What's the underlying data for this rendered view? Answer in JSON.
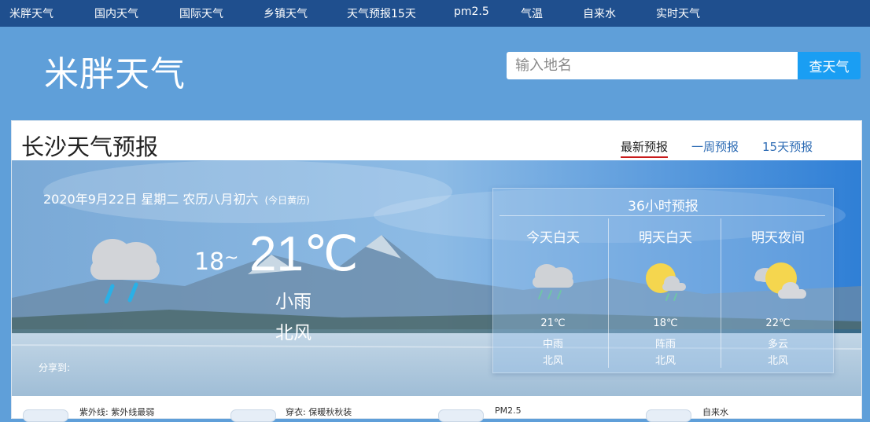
{
  "nav": {
    "items": [
      "米胖天气",
      "国内天气",
      "国际天气",
      "乡镇天气",
      "天气预报15天",
      "pm2.5",
      "气温",
      "自来水",
      "实时天气"
    ]
  },
  "header": {
    "logo": "米胖天气",
    "search_placeholder": "输入地名",
    "search_button": "查天气"
  },
  "card": {
    "title": "长沙天气预报",
    "tabs": [
      {
        "label": "最新预报",
        "active": true
      },
      {
        "label": "一周预报",
        "active": false
      },
      {
        "label": "15天预报",
        "active": false
      }
    ]
  },
  "today": {
    "date": "2020年9月22日 星期二 农历八月初六",
    "almanac": "(今日黄历)",
    "icon": "rain-cloud-icon",
    "temp_low": "18",
    "tilde": "~",
    "temp_high": "21℃",
    "weather": "小雨",
    "wind": "北风",
    "share_label": "分享到:"
  },
  "forecast36": {
    "title": "36小时预报",
    "periods": [
      {
        "name": "今天白天",
        "temp": "21℃",
        "weather": "中雨",
        "wind": "北风",
        "icon": "heavy-rain-cloud-icon"
      },
      {
        "name": "明天白天",
        "temp": "18℃",
        "weather": "阵雨",
        "wind": "北风",
        "icon": "sun-shower-icon"
      },
      {
        "name": "明天夜间",
        "temp": "22℃",
        "weather": "多云",
        "wind": "北风",
        "icon": "partly-cloudy-icon"
      }
    ]
  },
  "life": {
    "items": [
      "紫外线: 紫外线最弱",
      "穿衣: 保暖秋秋装",
      "PM2.5",
      "自来水"
    ]
  },
  "colors": {
    "nav_bg": "#1f4f8e",
    "page_bg": "#5f9fd9",
    "search_button": "#1a9ef3",
    "tab_link": "#2f6db5",
    "tab_underline": "#c91b1b",
    "sun": "#f5d64e"
  }
}
